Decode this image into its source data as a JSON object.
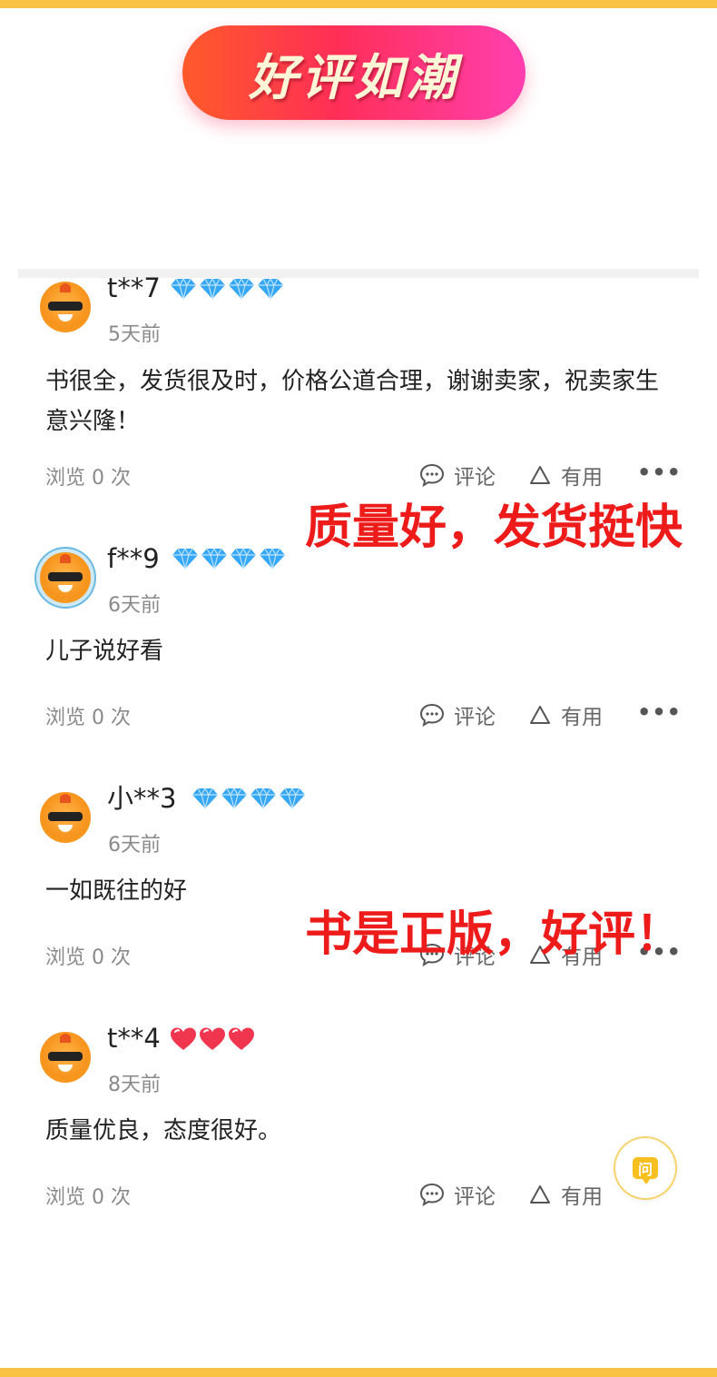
{
  "banner": {
    "title": "好评如潮"
  },
  "reviews": [
    {
      "username": "t**7",
      "badge_type": "diamond",
      "badge_count": 4,
      "time": "5天前",
      "content": "书很全，发货很及时，价格公道合理，谢谢卖家，祝卖家生意兴隆！",
      "views": "浏览 0 次",
      "comment_label": "评论",
      "useful_label": "有用",
      "more": "•••"
    },
    {
      "username": "f**9",
      "badge_type": "diamond",
      "badge_count": 4,
      "time": "6天前",
      "content": "儿子说好看",
      "views": "浏览 0 次",
      "comment_label": "评论",
      "useful_label": "有用",
      "more": "•••"
    },
    {
      "username": "小**3",
      "badge_type": "diamond",
      "badge_count": 4,
      "time": "6天前",
      "content": "一如既往的好",
      "views": "浏览 0 次",
      "comment_label": "评论",
      "useful_label": "有用",
      "more": "•••"
    },
    {
      "username": "t**4",
      "badge_type": "heart",
      "badge_count": 3,
      "time": "8天前",
      "content": "质量优良，态度很好。",
      "views": "浏览 0 次",
      "comment_label": "评论",
      "useful_label": "有用"
    }
  ],
  "overlays": {
    "first": "质量好，发货挺快",
    "second": "书是正版，好评！"
  },
  "ask_button": {
    "label": "问"
  },
  "colors": {
    "stripe": "#f9c242",
    "overlay_text": "#ee1b1b",
    "diamond": "#35a7f5",
    "heart": "#f0364f"
  }
}
